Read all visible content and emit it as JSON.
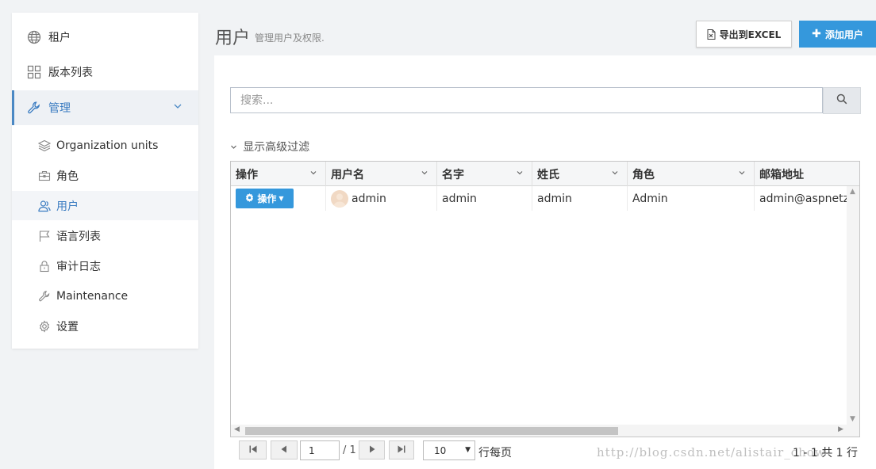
{
  "sidebar": {
    "items": [
      {
        "label": "租户",
        "icon": "globe-icon"
      },
      {
        "label": "版本列表",
        "icon": "grid-icon"
      },
      {
        "label": "管理",
        "icon": "wrench-icon",
        "expanded": true
      }
    ],
    "sub_items": [
      {
        "label": "Organization units",
        "icon": "layers-icon"
      },
      {
        "label": "角色",
        "icon": "briefcase-icon"
      },
      {
        "label": "用户",
        "icon": "users-icon",
        "active": true
      },
      {
        "label": "语言列表",
        "icon": "flag-icon"
      },
      {
        "label": "审计日志",
        "icon": "lock-icon"
      },
      {
        "label": "Maintenance",
        "icon": "wrench-icon"
      },
      {
        "label": "设置",
        "icon": "gear-icon"
      }
    ]
  },
  "header": {
    "title": "用户",
    "subtitle": "管理用户及权限.",
    "export_label": "导出到EXCEL",
    "add_label": "添加用户"
  },
  "search": {
    "placeholder": "搜索..."
  },
  "filter": {
    "advanced_label": "显示高级过滤"
  },
  "table": {
    "columns": [
      "操作",
      "用户名",
      "名字",
      "姓氏",
      "角色",
      "邮箱地址"
    ],
    "rows": [
      {
        "action_label": "操作",
        "username": "admin",
        "name": "admin",
        "surname": "admin",
        "role": "Admin",
        "email": "admin@aspnetzero.com"
      }
    ]
  },
  "pager": {
    "current_page": "1",
    "total_pages": "/ 1",
    "page_size": "10",
    "per_page_label": "行每页",
    "range_info": "1 - 1 共 1 行"
  },
  "watermark": "http://blog.csdn.net/alistair_chow",
  "colors": {
    "primary": "#3598dc",
    "active_menu": "#3b7cc1",
    "background": "#f1f3f5"
  }
}
